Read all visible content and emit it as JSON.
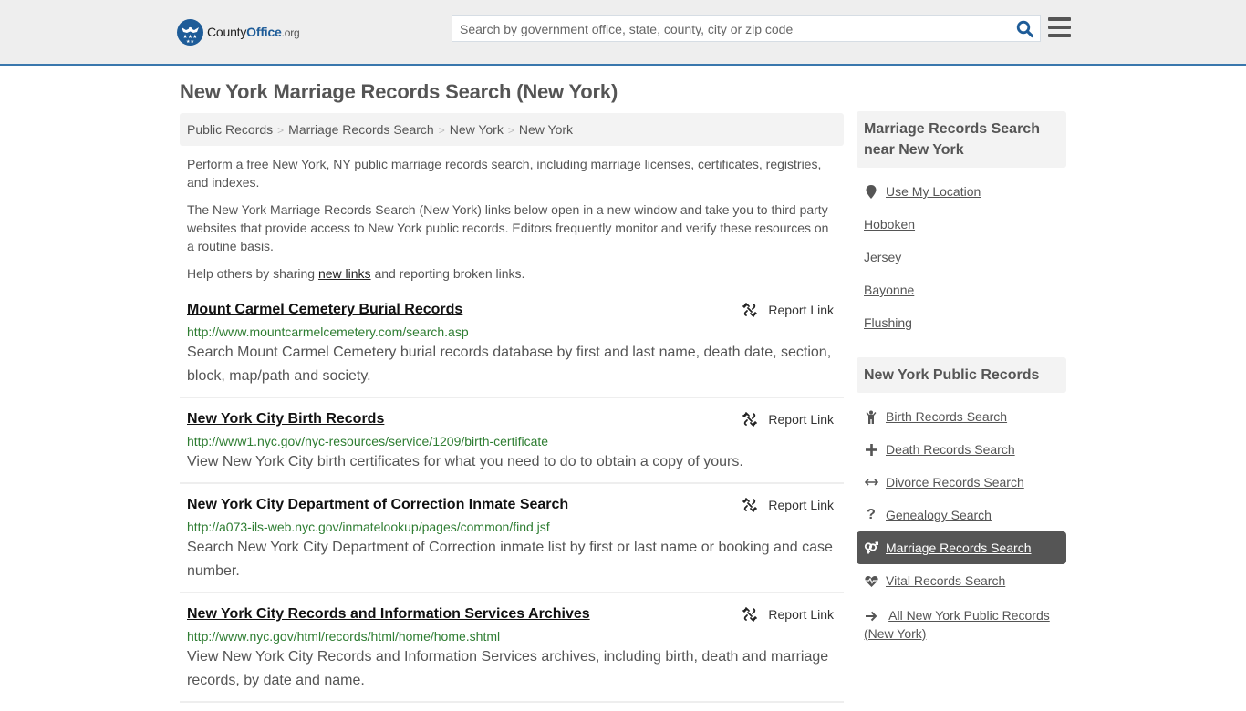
{
  "header": {
    "logo": {
      "brand_a": "County",
      "brand_b": "Office",
      "brand_c": ".org"
    },
    "search_placeholder": "Search by government office, state, county, city or zip code",
    "search_icon": "search-icon",
    "menu_icon": "hamburger-menu-icon"
  },
  "page": {
    "title": "New York Marriage Records Search (New York)",
    "breadcrumb": [
      "Public Records",
      "Marriage Records Search",
      "New York",
      "New York"
    ],
    "intro": {
      "p1": "Perform a free New York, NY public marriage records search, including marriage licenses, certificates, registries, and indexes.",
      "p2": "The New York Marriage Records Search (New York) links below open in a new window and take you to third party websites that provide access to New York public records. Editors frequently monitor and verify these resources on a routine basis.",
      "p3_before": "Help others by sharing ",
      "p3_link": "new links",
      "p3_after": " and reporting broken links."
    }
  },
  "results": [
    {
      "title": "Mount Carmel Cemetery Burial Records",
      "url": "http://www.mountcarmelcemetery.com/search.asp",
      "description": "Search Mount Carmel Cemetery burial records database by first and last name, death date, section, block, map/path and society.",
      "report_label": "Report Link"
    },
    {
      "title": "New York City Birth Records",
      "url": "http://www1.nyc.gov/nyc-resources/service/1209/birth-certificate",
      "description": "View New York City birth certificates for what you need to do to obtain a copy of yours.",
      "report_label": "Report Link"
    },
    {
      "title": "New York City Department of Correction Inmate Search",
      "url": "http://a073-ils-web.nyc.gov/inmatelookup/pages/common/find.jsf",
      "description": "Search New York City Department of Correction inmate list by first or last name or booking and case number.",
      "report_label": "Report Link"
    },
    {
      "title": "New York City Records and Information Services Archives",
      "url": "http://www.nyc.gov/html/records/html/home/home.shtml",
      "description": "View New York City Records and Information Services archives, including birth, death and marriage records, by date and name.",
      "report_label": "Report Link"
    }
  ],
  "sidebar": {
    "nearby": {
      "heading": "Marriage Records Search near New York",
      "use_location": "Use My Location",
      "places": [
        "Hoboken",
        "Jersey",
        "Bayonne",
        "Flushing"
      ]
    },
    "public_records": {
      "heading": "New York Public Records",
      "items": [
        {
          "label": "Birth Records Search",
          "icon": "child-icon"
        },
        {
          "label": "Death Records Search",
          "icon": "plus-icon"
        },
        {
          "label": "Divorce Records Search",
          "icon": "arrows-horizontal-icon"
        },
        {
          "label": "Genealogy Search",
          "icon": "question-icon"
        },
        {
          "label": "Marriage Records Search",
          "icon": "venus-mars-icon",
          "active": true
        },
        {
          "label": "Vital Records Search",
          "icon": "heartbeat-icon"
        },
        {
          "label": "All New York Public Records (New York)",
          "icon": "arrow-right-icon"
        }
      ]
    }
  },
  "colors": {
    "brand_blue": "#1e5c98",
    "header_border": "#3a77ad",
    "url_green": "#2e7d32",
    "active_bg": "#555555"
  }
}
